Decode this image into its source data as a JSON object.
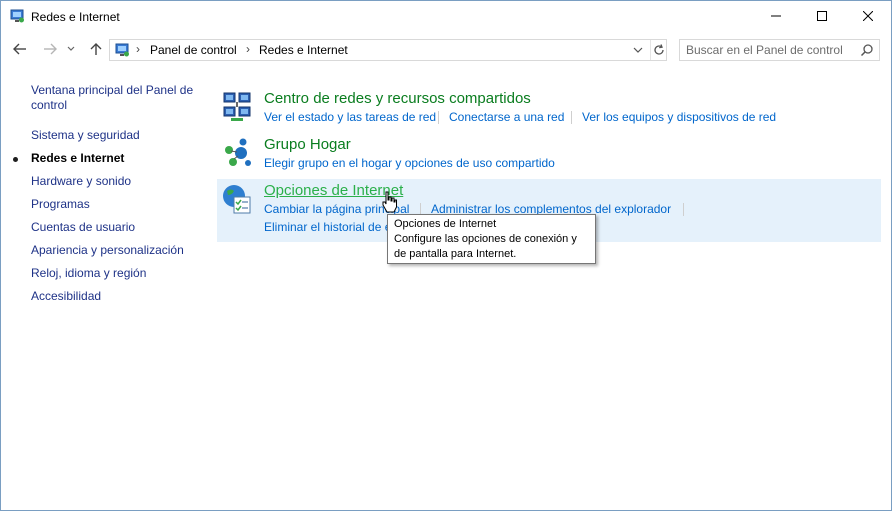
{
  "window": {
    "title": "Redes e Internet"
  },
  "address": {
    "crumbs": [
      "Panel de control",
      "Redes e Internet"
    ]
  },
  "search": {
    "placeholder": "Buscar en el Panel de control"
  },
  "sidebar": {
    "items": [
      {
        "label": "Ventana principal del Panel de control",
        "active": false
      },
      {
        "label": "Sistema y seguridad",
        "active": false
      },
      {
        "label": "Redes e Internet",
        "active": true
      },
      {
        "label": "Hardware y sonido",
        "active": false
      },
      {
        "label": "Programas",
        "active": false
      },
      {
        "label": "Cuentas de usuario",
        "active": false
      },
      {
        "label": "Apariencia y personalización",
        "active": false
      },
      {
        "label": "Reloj, idioma y región",
        "active": false
      },
      {
        "label": "Accesibilidad",
        "active": false
      }
    ]
  },
  "categories": [
    {
      "title": "Centro de redes y recursos compartidos",
      "icon": "network-center-icon",
      "links": [
        "Ver el estado y las tareas de red",
        "Conectarse a una red",
        "Ver los equipos y dispositivos de red"
      ]
    },
    {
      "title": "Grupo Hogar",
      "icon": "homegroup-icon",
      "links": [
        "Elegir grupo en el hogar y opciones de uso compartido"
      ]
    },
    {
      "title": "Opciones de Internet",
      "icon": "internet-options-icon",
      "links": [
        "Cambiar la página principal",
        "Administrar los complementos del explorador",
        "Eliminar el historial de exploración y las cookies"
      ]
    }
  ],
  "tooltip": {
    "title": "Opciones de Internet",
    "line1": "Configure las opciones de conexión y",
    "line2": "de pantalla para Internet."
  },
  "colors": {
    "category_title": "#0a7d1f",
    "category_title_hover": "#2bb04a",
    "link": "#0066cc",
    "hover_bg": "#e5f1fb"
  }
}
